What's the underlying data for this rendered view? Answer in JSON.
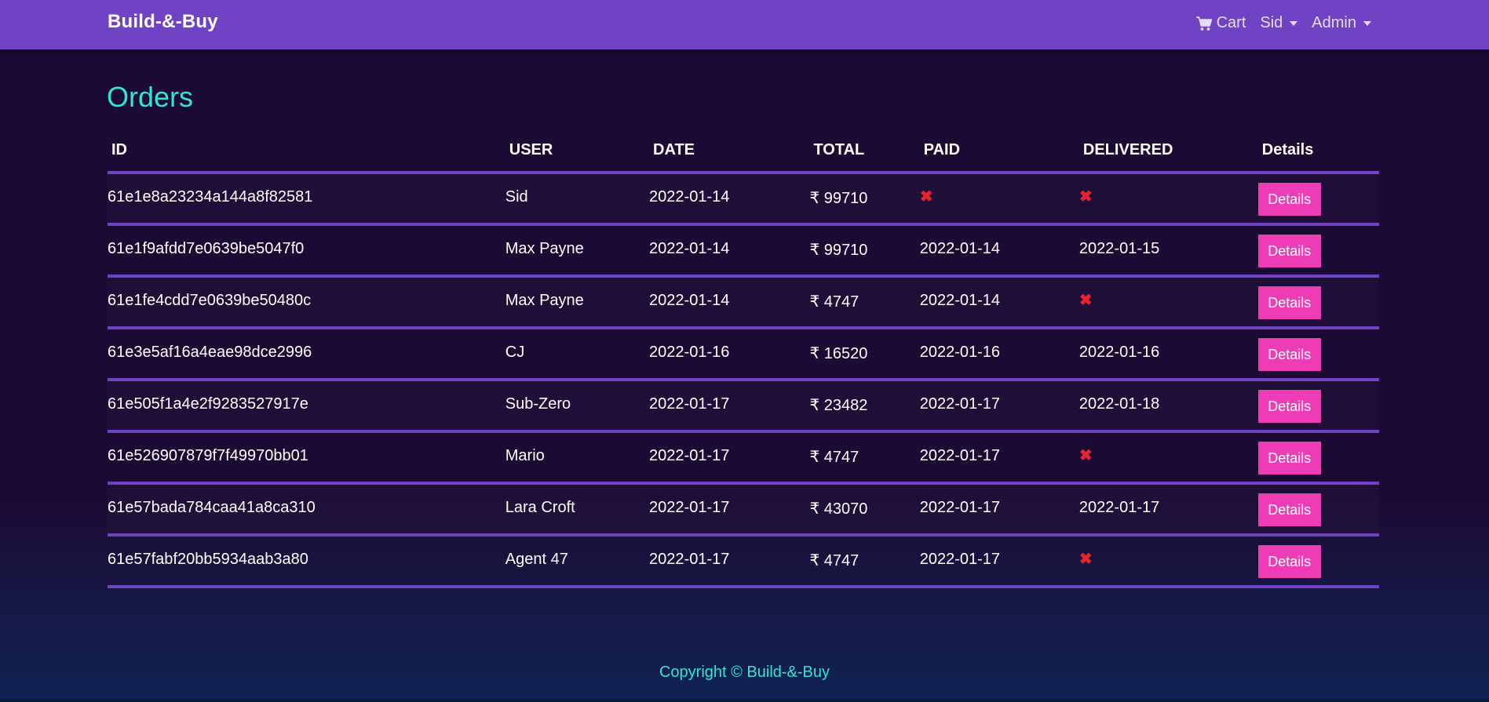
{
  "brand": "Build-&-Buy",
  "nav": {
    "cart_label": "Cart",
    "cart_icon": "cart-icon",
    "user_menu": "Sid",
    "admin_menu": "Admin"
  },
  "page_title": "Orders",
  "table": {
    "headers": [
      "ID",
      "USER",
      "DATE",
      "TOTAL",
      "PAID",
      "DELIVERED",
      "Details"
    ],
    "rows": [
      {
        "id": "61e1e8a23234a144a8f82581",
        "user": "Sid",
        "date": "2022-01-14",
        "total": "₹ 99710",
        "paid": "✖",
        "delivered": "✖",
        "details": "Details"
      },
      {
        "id": "61e1f9afdd7e0639be5047f0",
        "user": "Max Payne",
        "date": "2022-01-14",
        "total": "₹ 99710",
        "paid": "2022-01-14",
        "delivered": "2022-01-15",
        "details": "Details"
      },
      {
        "id": "61e1fe4cdd7e0639be50480c",
        "user": "Max Payne",
        "date": "2022-01-14",
        "total": "₹ 4747",
        "paid": "2022-01-14",
        "delivered": "✖",
        "details": "Details"
      },
      {
        "id": "61e3e5af16a4eae98dce2996",
        "user": "CJ",
        "date": "2022-01-16",
        "total": "₹ 16520",
        "paid": "2022-01-16",
        "delivered": "2022-01-16",
        "details": "Details"
      },
      {
        "id": "61e505f1a4e2f9283527917e",
        "user": "Sub-Zero",
        "date": "2022-01-17",
        "total": "₹ 23482",
        "paid": "2022-01-17",
        "delivered": "2022-01-18",
        "details": "Details"
      },
      {
        "id": "61e526907879f7f49970bb01",
        "user": "Mario",
        "date": "2022-01-17",
        "total": "₹ 4747",
        "paid": "2022-01-17",
        "delivered": "✖",
        "details": "Details"
      },
      {
        "id": "61e57bada784caa41a8ca310",
        "user": "Lara Croft",
        "date": "2022-01-17",
        "total": "₹ 43070",
        "paid": "2022-01-17",
        "delivered": "2022-01-17",
        "details": "Details"
      },
      {
        "id": "61e57fabf20bb5934aab3a80",
        "user": "Agent 47",
        "date": "2022-01-17",
        "total": "₹ 4747",
        "paid": "2022-01-17",
        "delivered": "✖",
        "details": "Details"
      }
    ]
  },
  "footer": "Copyright © Build-&-Buy",
  "colors": {
    "navbar": "#7043c4",
    "accent": "#2ee6d6",
    "button": "#ee3bb6",
    "not_marker": "#e8222f"
  }
}
